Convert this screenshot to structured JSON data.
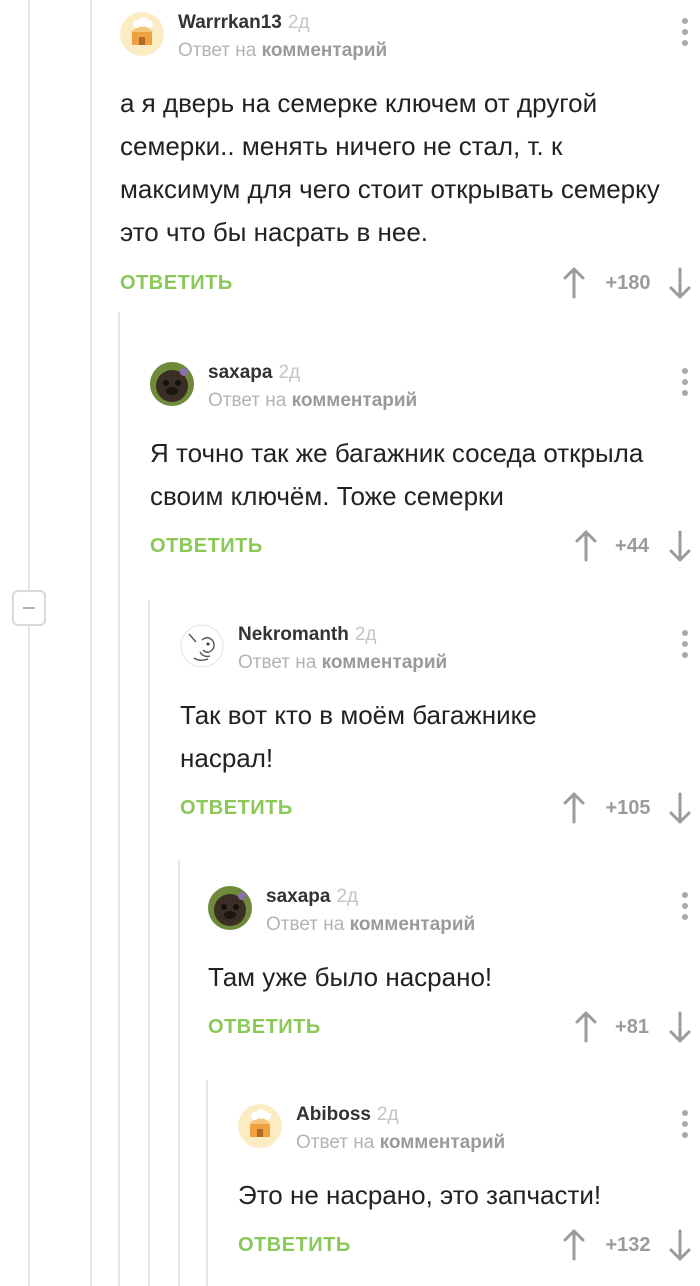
{
  "labels": {
    "reply_to_prefix": "Ответ на",
    "reply_to_target": "комментарий",
    "reply_button": "ОТВЕТИТЬ"
  },
  "colors": {
    "accent_green": "#8ac858",
    "muted_gray": "#b3b3b3"
  },
  "icons": {
    "upvote": "arrow-up-icon",
    "downvote": "arrow-down-icon",
    "menu": "more-vertical-icon",
    "collapse": "minus-icon"
  },
  "comments": [
    {
      "username": "Warrrkan13",
      "time": "2д",
      "avatar": "default-avatar",
      "text": "а я дверь на семерке ключем от другой семерки.. менять ничего не стал, т. к максимум для чего стоит открывать семерку это что бы насрать в нее.",
      "score": "+180"
    },
    {
      "username": "saxapa",
      "time": "2д",
      "avatar": "pug-photo-avatar",
      "text": "Я точно так же багажник соседа открыла своим ключём. Тоже семерки",
      "score": "+44"
    },
    {
      "username": "Nekromanth",
      "time": "2д",
      "avatar": "sketch-avatar",
      "text": "Так вот кто в моём багажнике насрал!",
      "score": "+105"
    },
    {
      "username": "saxapa",
      "time": "2д",
      "avatar": "pug-photo-avatar",
      "text": "Там уже было насрано!",
      "score": "+81"
    },
    {
      "username": "Abiboss",
      "time": "2д",
      "avatar": "default-avatar",
      "text": "Это не насрано, это запчасти!",
      "score": "+132"
    }
  ]
}
